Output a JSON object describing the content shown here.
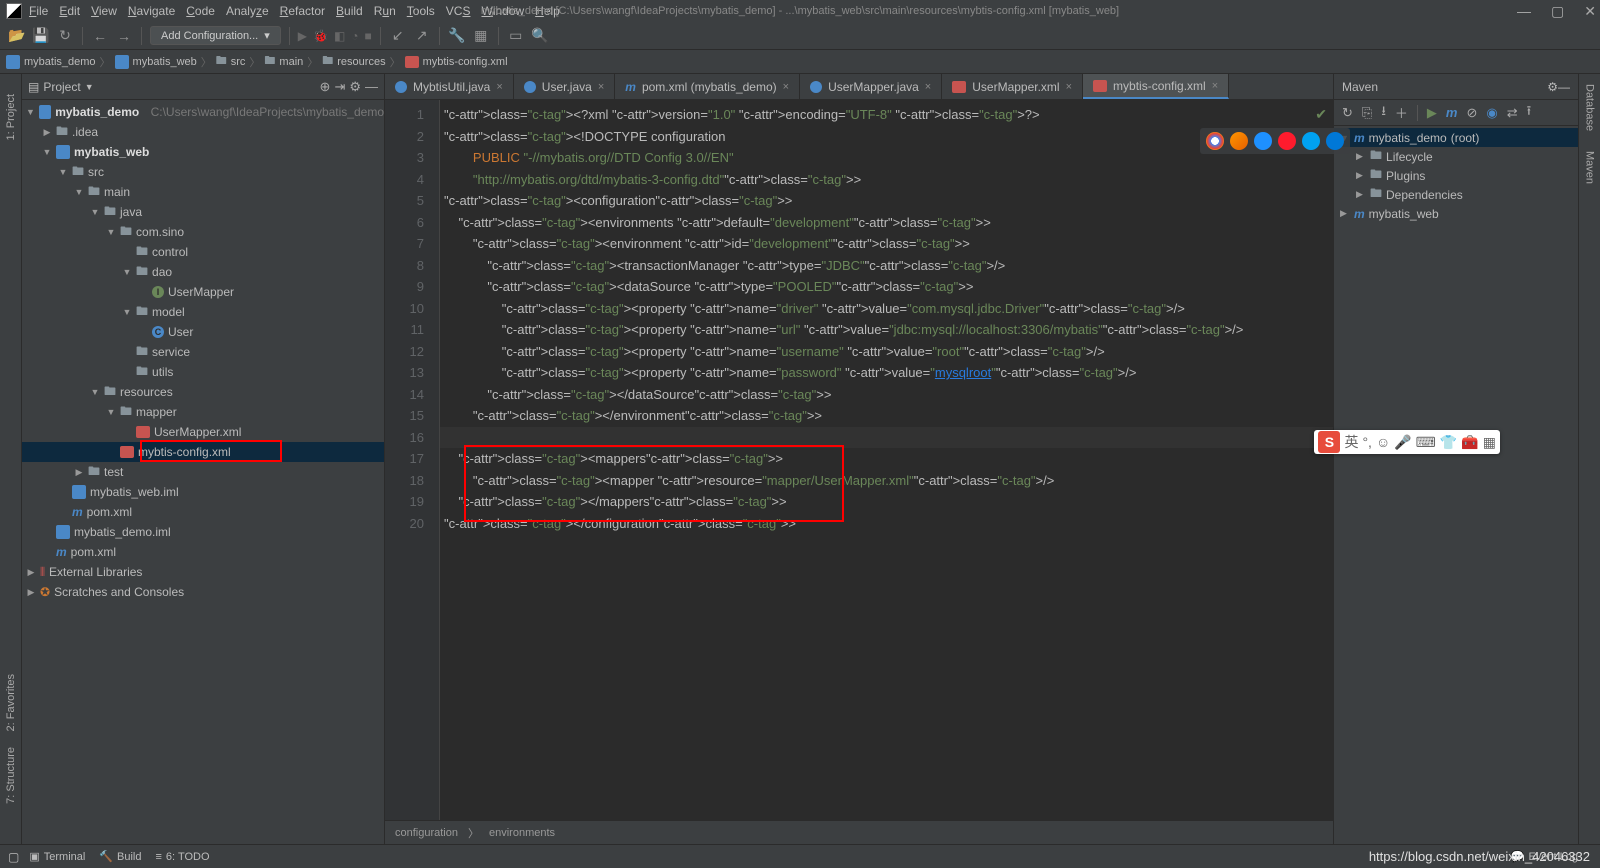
{
  "title": "mybatis_demo [C:\\Users\\wangf\\IdeaProjects\\mybatis_demo] - ...\\mybatis_web\\src\\main\\resources\\mybtis-config.xml [mybatis_web]",
  "menus": [
    "File",
    "Edit",
    "View",
    "Navigate",
    "Code",
    "Analyze",
    "Refactor",
    "Build",
    "Run",
    "Tools",
    "VCS",
    "Window",
    "Help"
  ],
  "addConfiguration": "Add Configuration...",
  "breadcrumbs": [
    "mybatis_demo",
    "mybatis_web",
    "src",
    "main",
    "resources",
    "mybtis-config.xml"
  ],
  "projectPanel": {
    "title": "Project"
  },
  "tree": {
    "root": {
      "name": "mybatis_demo",
      "path": "C:\\Users\\wangf\\IdeaProjects\\mybatis_demo"
    },
    "items": [
      {
        "indent": 1,
        "tw": "▶",
        "icon": "folder",
        "label": ".idea"
      },
      {
        "indent": 1,
        "tw": "▼",
        "icon": "module",
        "label": "mybatis_web",
        "bold": true
      },
      {
        "indent": 2,
        "tw": "▼",
        "icon": "folder",
        "label": "src"
      },
      {
        "indent": 3,
        "tw": "▼",
        "icon": "folder",
        "label": "main"
      },
      {
        "indent": 4,
        "tw": "▼",
        "icon": "folder-blue",
        "label": "java"
      },
      {
        "indent": 5,
        "tw": "▼",
        "icon": "package",
        "label": "com.sino"
      },
      {
        "indent": 6,
        "tw": "",
        "icon": "package",
        "label": "control"
      },
      {
        "indent": 6,
        "tw": "▼",
        "icon": "package",
        "label": "dao"
      },
      {
        "indent": 7,
        "tw": "",
        "icon": "interface",
        "label": "UserMapper"
      },
      {
        "indent": 6,
        "tw": "▼",
        "icon": "package",
        "label": "model"
      },
      {
        "indent": 7,
        "tw": "",
        "icon": "class",
        "label": "User"
      },
      {
        "indent": 6,
        "tw": "",
        "icon": "package",
        "label": "service"
      },
      {
        "indent": 6,
        "tw": "",
        "icon": "package",
        "label": "utils"
      },
      {
        "indent": 4,
        "tw": "▼",
        "icon": "folder-res",
        "label": "resources"
      },
      {
        "indent": 5,
        "tw": "▼",
        "icon": "package",
        "label": "mapper"
      },
      {
        "indent": 6,
        "tw": "",
        "icon": "xml",
        "label": "UserMapper.xml"
      },
      {
        "indent": 5,
        "tw": "",
        "icon": "xml",
        "label": "mybtis-config.xml",
        "sel": true,
        "redbox": true
      },
      {
        "indent": 3,
        "tw": "▶",
        "icon": "folder",
        "label": "test"
      },
      {
        "indent": 2,
        "tw": "",
        "icon": "ij",
        "label": "mybatis_web.iml"
      },
      {
        "indent": 2,
        "tw": "",
        "icon": "m",
        "label": "pom.xml"
      },
      {
        "indent": 1,
        "tw": "",
        "icon": "ij",
        "label": "mybatis_demo.iml"
      },
      {
        "indent": 1,
        "tw": "",
        "icon": "m",
        "label": "pom.xml"
      }
    ],
    "extras": [
      "External Libraries",
      "Scratches and Consoles"
    ]
  },
  "leftGutter": [
    "1: Project",
    "2: Favorites",
    "7: Structure"
  ],
  "rightGutter": [
    "Database",
    "Maven"
  ],
  "editorTabs": [
    {
      "icon": "java",
      "label": "MybtisUtil.java",
      "close": true
    },
    {
      "icon": "java",
      "label": "User.java",
      "close": true
    },
    {
      "icon": "m",
      "label": "pom.xml (mybatis_demo)",
      "close": true
    },
    {
      "icon": "java",
      "label": "UserMapper.java",
      "close": true
    },
    {
      "icon": "xml",
      "label": "UserMapper.xml",
      "close": true
    },
    {
      "icon": "xml",
      "label": "mybtis-config.xml",
      "close": true,
      "active": true
    }
  ],
  "lines": 20,
  "editorBreadcrumb": [
    "configuration",
    "environments"
  ],
  "codeLines": [
    "<?xml version=\"1.0\" encoding=\"UTF-8\" ?>",
    "<!DOCTYPE configuration",
    "        PUBLIC \"-//mybatis.org//DTD Config 3.0//EN\"",
    "        \"http://mybatis.org/dtd/mybatis-3-config.dtd\">",
    "<configuration>",
    "    <environments default=\"development\">",
    "        <environment id=\"development\">",
    "            <transactionManager type=\"JDBC\"/>",
    "            <dataSource type=\"POOLED\">",
    "                <property name=\"driver\" value=\"com.mysql.jdbc.Driver\"/>",
    "                <property name=\"url\" value=\"jdbc:mysql://localhost:3306/mybatis\"/>",
    "                <property name=\"username\" value=\"root\"/>",
    "                <property name=\"password\" value=\"mysqlroot\"/>",
    "            </dataSource>",
    "        </environment>",
    "    </environments>",
    "    <mappers>",
    "        <mapper resource=\"mapper/UserMapper.xml\"/>",
    "    </mappers>",
    "</configuration>"
  ],
  "maven": {
    "title": "Maven",
    "items": [
      {
        "indent": 0,
        "tw": "▼",
        "label": "mybatis_demo",
        "suffix": "(root)",
        "sel": true
      },
      {
        "indent": 1,
        "tw": "▶",
        "label": "Lifecycle",
        "icon": "lc"
      },
      {
        "indent": 1,
        "tw": "▶",
        "label": "Plugins",
        "icon": "pl"
      },
      {
        "indent": 1,
        "tw": "▶",
        "label": "Dependencies",
        "icon": "dep"
      },
      {
        "indent": 0,
        "tw": "▶",
        "label": "mybatis_web",
        "icon": "m"
      }
    ]
  },
  "statusItems": {
    "terminal": "Terminal",
    "build": "Build",
    "todo": "6: TODO",
    "eventLog": "Event Log"
  },
  "watermark": "https://blog.csdn.net/weixin_42046332"
}
